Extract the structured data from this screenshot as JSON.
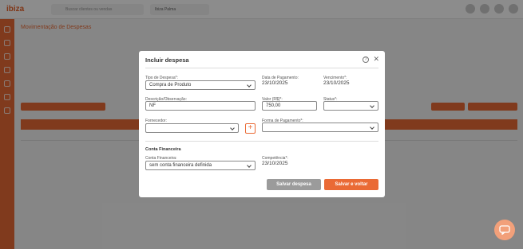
{
  "app": {
    "logo": "ibiza",
    "search_placeholder": "Buscar clientes ou vendas",
    "shop_selector": "Ibiza Palma",
    "page_title": "Movimentação de Despesas"
  },
  "modal": {
    "title": "Incluir despesa",
    "fields": {
      "tipo_despesa_label": "Tipo de Despesa*:",
      "tipo_despesa_value": "Compra de Produto",
      "data_pagamento_label": "Data de Pagamento:",
      "data_pagamento_value": "23/10/2025",
      "vencimento_label": "Vencimento*:",
      "vencimento_value": "23/10/2025",
      "descricao_label": "Descrição/Observação:",
      "descricao_value": "NF",
      "valor_label": "Valor (R$)*:",
      "valor_value": "750,00",
      "status_label": "Status*:",
      "status_value": "",
      "fornecedor_label": "Fornecedor:",
      "fornecedor_value": "",
      "forma_pagamento_label": "Forma de Pagamento*:",
      "forma_pagamento_value": "",
      "conta_financeira_section": "Conta Financeira",
      "conta_financeira_label": "Conta Financeira:",
      "conta_financeira_value": "sem conta financeira definida",
      "competencia_label": "Competência*:",
      "competencia_value": "23/10/2025"
    },
    "buttons": {
      "save": "Salvar despesa",
      "save_and_back": "Salvar e voltar"
    }
  },
  "colors": {
    "accent": "#ea6a35",
    "button_gray": "#9b9b9b"
  }
}
